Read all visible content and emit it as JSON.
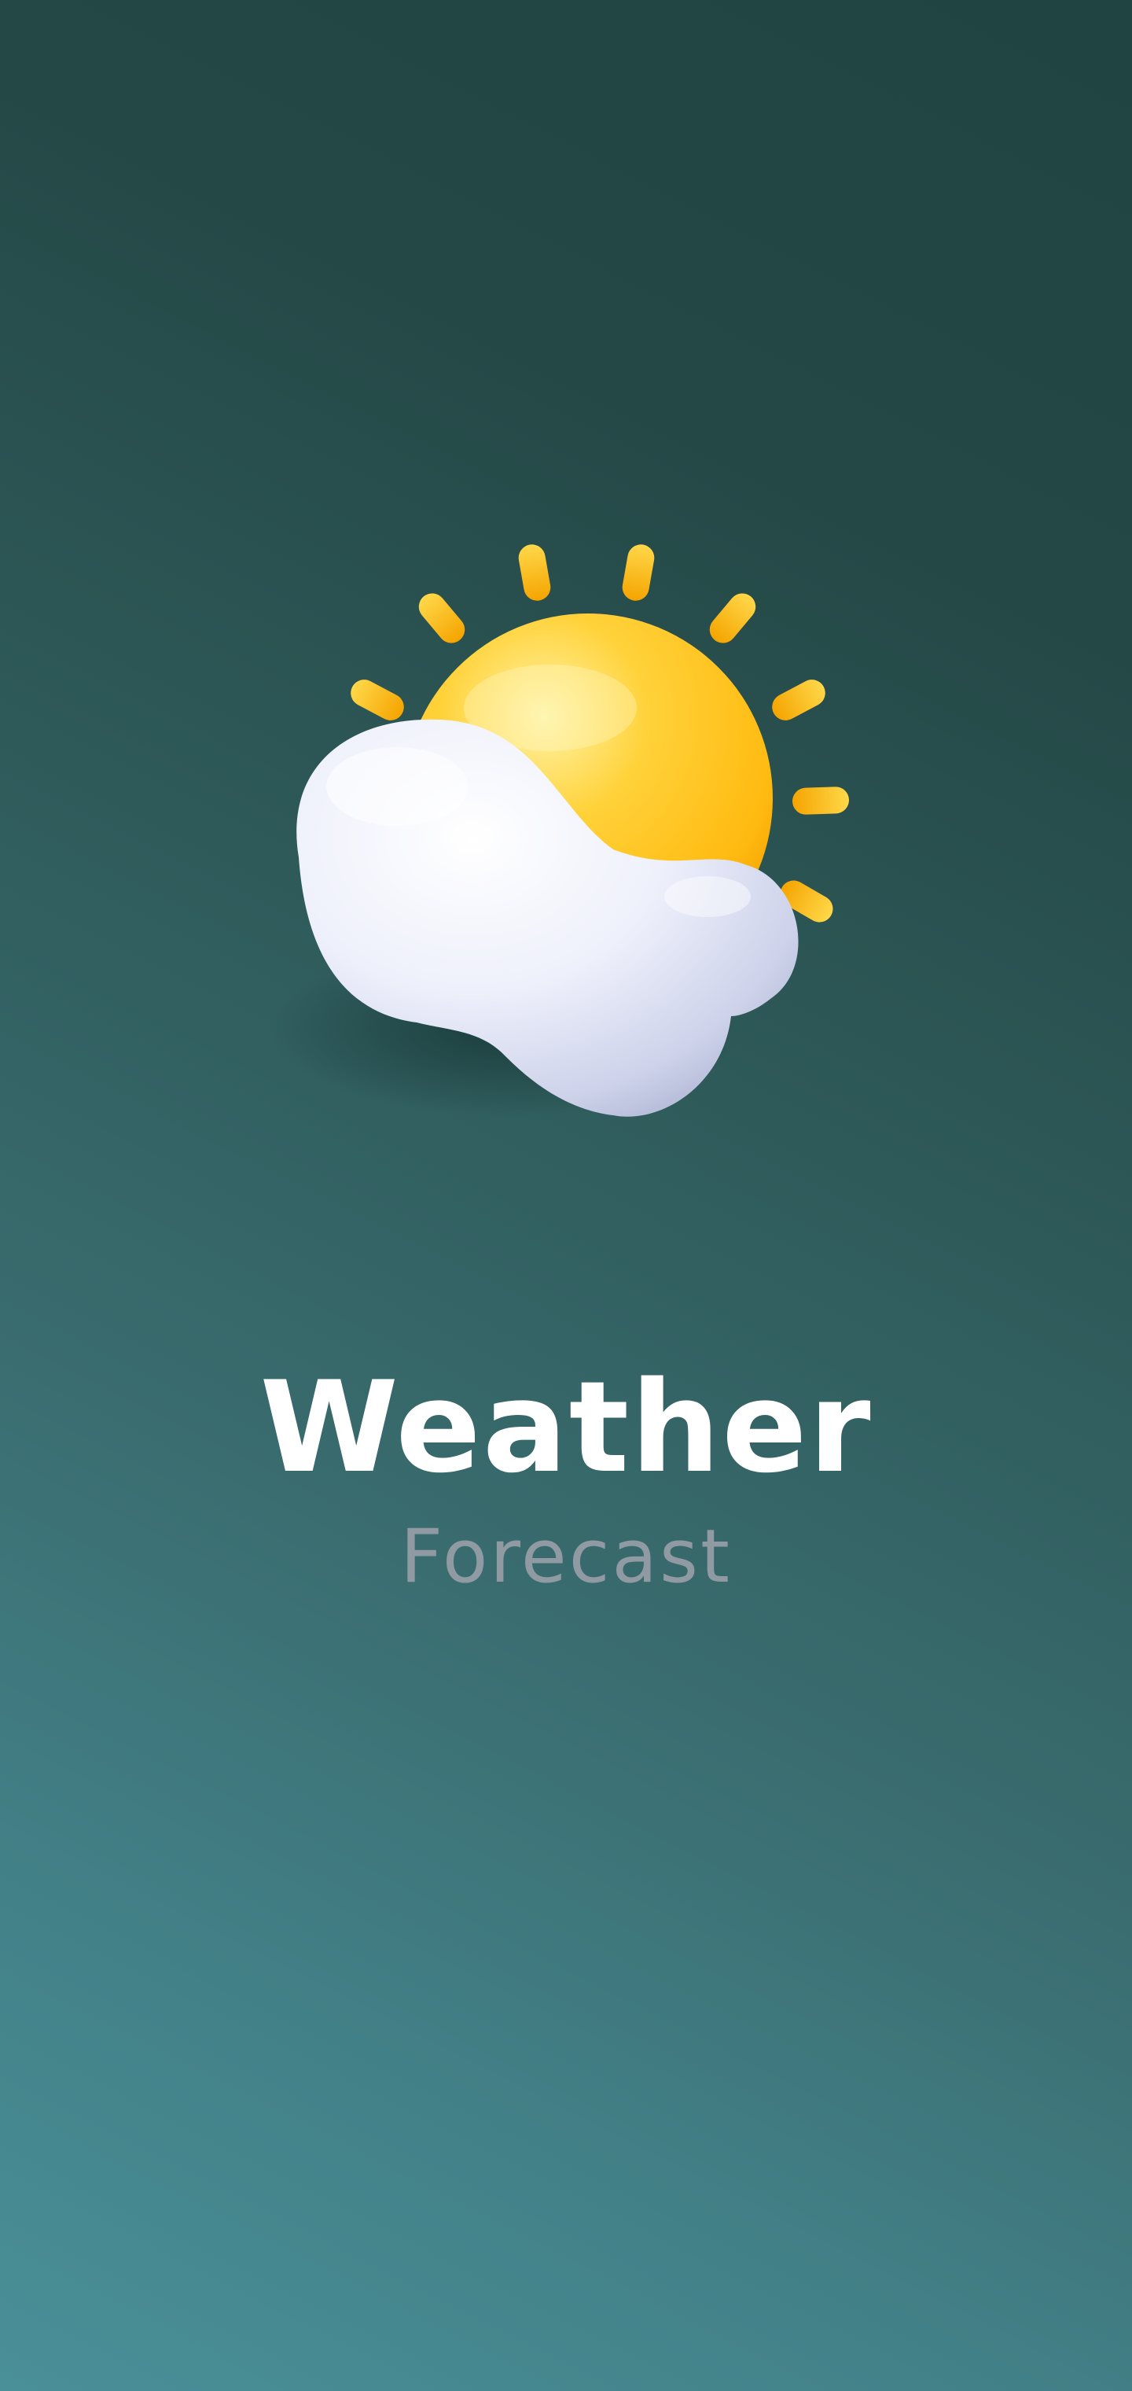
{
  "splash": {
    "title": "Weather",
    "subtitle": "Forecast",
    "icon": "sun-behind-cloud-icon"
  },
  "colors": {
    "background_top": "#1f4442",
    "background_bottom": "#4a9098",
    "sun": "#ffc21a",
    "cloud": "#e4e8f8",
    "title": "#ffffff",
    "subtitle": "#8f9aa3"
  }
}
